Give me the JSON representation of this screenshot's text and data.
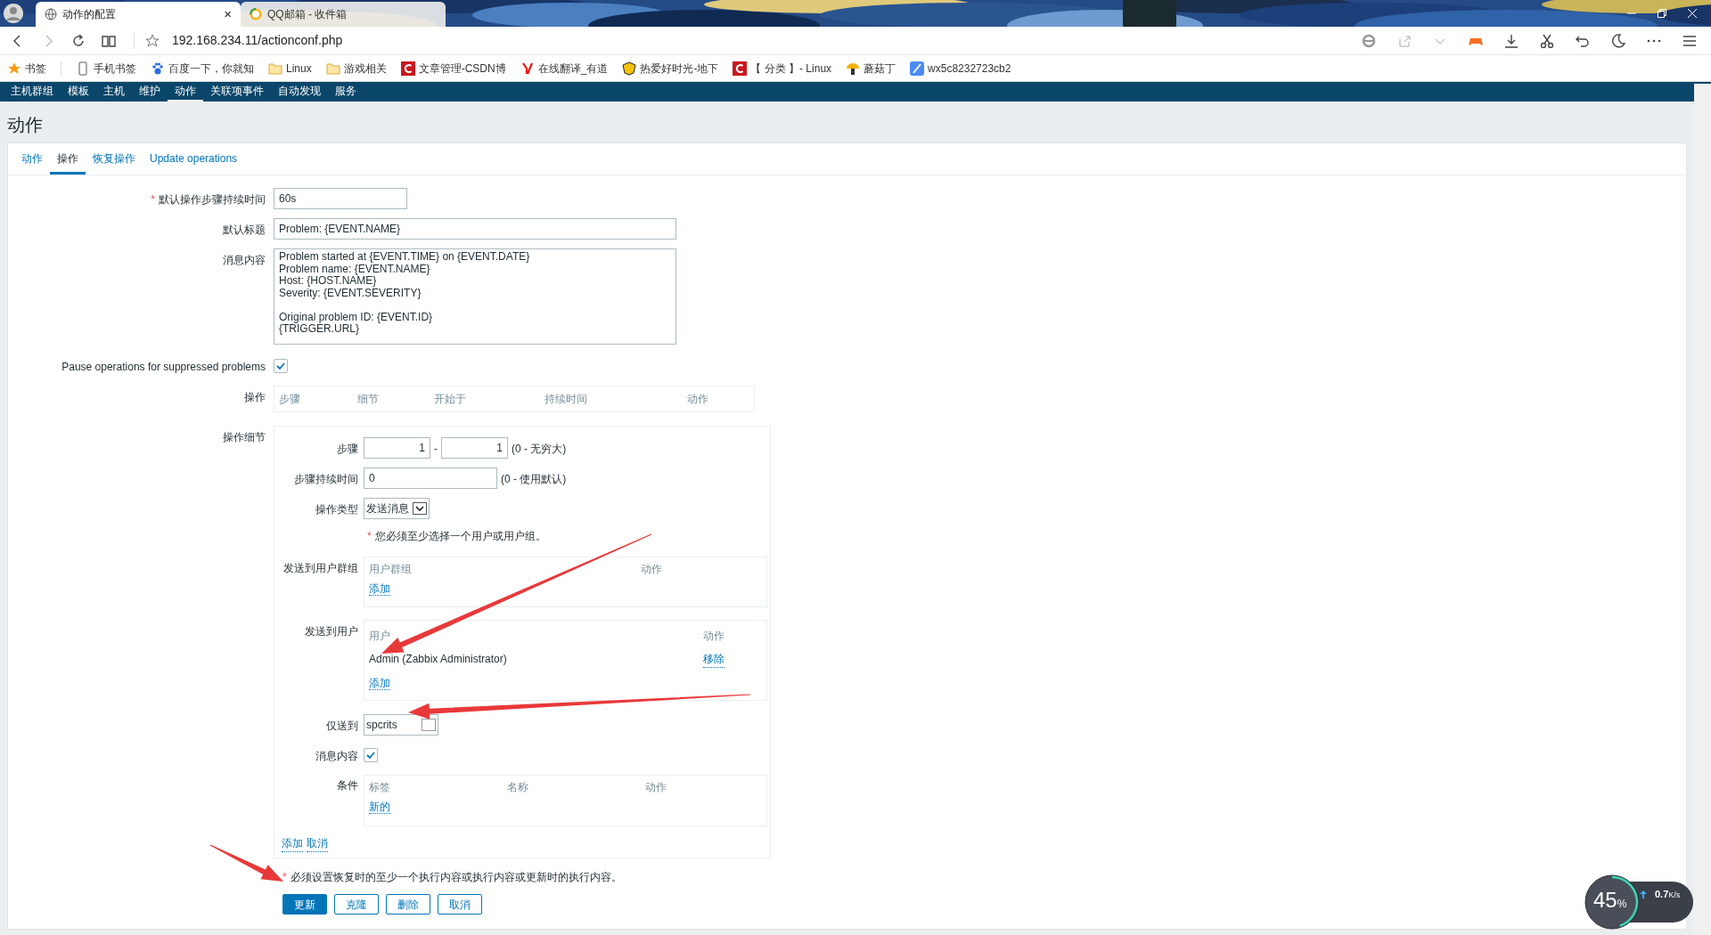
{
  "browser": {
    "tabs": [
      {
        "title": "动作的配置",
        "selected": true,
        "close": "×"
      },
      {
        "title": "QQ邮箱 - 收件箱",
        "selected": false
      }
    ],
    "address": "192.168.234.11/actionconf.php",
    "bookmarks": [
      {
        "kind": "star",
        "label": "书签"
      },
      {
        "kind": "phone",
        "label": "手机书签"
      },
      {
        "kind": "paw",
        "label": "百度一下，你就知"
      },
      {
        "kind": "folder",
        "label": "Linux"
      },
      {
        "kind": "folder",
        "label": "游戏相关"
      },
      {
        "kind": "csdn",
        "label": "文章管理-CSDN博"
      },
      {
        "kind": "youdao",
        "label": "在线翻译_有道"
      },
      {
        "kind": "badge",
        "label": "热爱好时光-地下"
      },
      {
        "kind": "csdn",
        "label": "【 分类 】- Linux"
      },
      {
        "kind": "mushroom",
        "label": "蘑菇丁"
      },
      {
        "kind": "quill",
        "label": "wx5c8232723cb2"
      }
    ]
  },
  "nav": [
    {
      "label": "主机群组",
      "selected": false
    },
    {
      "label": "模板",
      "selected": false
    },
    {
      "label": "主机",
      "selected": false
    },
    {
      "label": "维护",
      "selected": false
    },
    {
      "label": "动作",
      "selected": true
    },
    {
      "label": "关联项事件",
      "selected": false
    },
    {
      "label": "自动发现",
      "selected": false
    },
    {
      "label": "服务",
      "selected": false
    }
  ],
  "page_title": "动作",
  "tabs": [
    {
      "label": "动作",
      "selected": false
    },
    {
      "label": "操作",
      "selected": true
    },
    {
      "label": "恢复操作",
      "selected": false
    },
    {
      "label": "Update operations",
      "selected": false
    }
  ],
  "form": {
    "step_duration": {
      "mark": "*",
      "label": "默认操作步骤持续时间",
      "value": "60s"
    },
    "default_subject": {
      "label": "默认标题",
      "value": "Problem: {EVENT.NAME}"
    },
    "message": {
      "label": "消息内容",
      "value": "Problem started at {EVENT.TIME} on {EVENT.DATE}\nProblem name: {EVENT.NAME}\nHost: {HOST.NAME}\nSeverity: {EVENT.SEVERITY}\n\nOriginal problem ID: {EVENT.ID}\n{TRIGGER.URL}"
    },
    "pause": {
      "label": "Pause operations for suppressed problems",
      "checked": true
    },
    "operations": {
      "label": "操作",
      "columns": [
        "步骤",
        "细节",
        "开始于",
        "持续时间",
        "动作"
      ]
    },
    "details": {
      "label": "操作细节",
      "steps": {
        "label": "步骤",
        "from": "1",
        "separator": "-",
        "to": "1",
        "hint": "(0 - 无穷大)"
      },
      "step_duration": {
        "label": "步骤持续时间",
        "value": "0",
        "hint": "(0 - 使用默认)"
      },
      "operation_type": {
        "label": "操作类型",
        "value": "发送消息"
      },
      "note": {
        "mark": "*",
        "text": "您必须至少选择一个用户或用户组。"
      },
      "user_groups": {
        "label": "发送到用户群组",
        "columns": [
          "用户群组",
          "动作"
        ],
        "add": "添加"
      },
      "users": {
        "label": "发送到用户",
        "columns": [
          "用户",
          "动作"
        ],
        "rows": [
          {
            "name": "Admin (Zabbix Administrator)",
            "action": "移除"
          }
        ],
        "add": "添加"
      },
      "send_only_to": {
        "label": "仅送到",
        "value": "spcrits"
      },
      "message_content": {
        "label": "消息内容",
        "checked": true
      },
      "conditions": {
        "label": "条件",
        "columns": [
          "标签",
          "名称",
          "动作"
        ],
        "new": "新的"
      },
      "links": [
        "添加",
        "取消"
      ]
    },
    "footer_note": {
      "mark": "*",
      "text": "必须设置恢复时的至少一个执行内容或执行内容或更新时的执行内容。"
    },
    "buttons": [
      {
        "label": "更新",
        "primary": true
      },
      {
        "label": "克隆",
        "primary": false
      },
      {
        "label": "删除",
        "primary": false
      },
      {
        "label": "取消",
        "primary": false
      }
    ]
  },
  "speed_widget": {
    "percent": "45",
    "unit": "%",
    "level": 0.45,
    "upload": "0.7",
    "upload_unit": "K/s"
  }
}
